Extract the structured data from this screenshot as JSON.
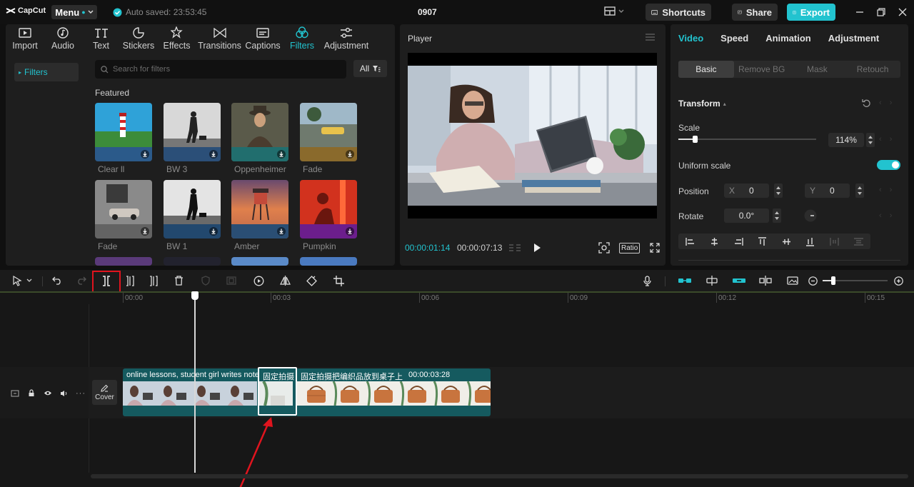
{
  "titlebar": {
    "app_name": "CapCut",
    "menu_label": "Menu",
    "autosave_text": "Auto saved: 23:53:45",
    "project_title": "0907",
    "shortcuts_label": "Shortcuts",
    "share_label": "Share",
    "export_label": "Export"
  },
  "media": {
    "tabs": [
      {
        "label": "Import",
        "icon": "import-icon"
      },
      {
        "label": "Audio",
        "icon": "audio-icon"
      },
      {
        "label": "Text",
        "icon": "text-icon"
      },
      {
        "label": "Stickers",
        "icon": "stickers-icon"
      },
      {
        "label": "Effects",
        "icon": "effects-icon"
      },
      {
        "label": "Transitions",
        "icon": "transitions-icon"
      },
      {
        "label": "Captions",
        "icon": "captions-icon"
      },
      {
        "label": "Filters",
        "icon": "filters-icon",
        "active": true
      },
      {
        "label": "Adjustment",
        "icon": "adjustment-icon"
      }
    ],
    "side_item": "Filters",
    "search_placeholder": "Search for filters",
    "all_label": "All",
    "section_title": "Featured",
    "filters": [
      {
        "name": "Clear ll"
      },
      {
        "name": "BW 3"
      },
      {
        "name": "Oppenheimer"
      },
      {
        "name": "Fade"
      },
      {
        "name": "Fade"
      },
      {
        "name": "BW 1"
      },
      {
        "name": "Amber"
      },
      {
        "name": "Pumpkin"
      }
    ]
  },
  "player": {
    "title": "Player",
    "current_time": "00:00:01:14",
    "total_time": "00:00:07:13",
    "ratio_label": "Ratio"
  },
  "props": {
    "tabs": [
      "Video",
      "Speed",
      "Animation",
      "Adjustment"
    ],
    "subtabs": [
      "Basic",
      "Remove BG",
      "Mask",
      "Retouch"
    ],
    "transform_label": "Transform",
    "scale_label": "Scale",
    "scale_value": "114%",
    "scale_fraction": 0.12,
    "uniform_scale_label": "Uniform scale",
    "uniform_scale_on": true,
    "position_label": "Position",
    "pos_x_label": "X",
    "pos_x_value": "0",
    "pos_y_label": "Y",
    "pos_y_value": "0",
    "rotate_label": "Rotate",
    "rotate_value": "0.0°"
  },
  "timeline": {
    "ruler_labels": [
      "00:00",
      "00:03",
      "00:06",
      "00:09",
      "00:12",
      "00:15"
    ],
    "cover_label": "Cover",
    "clips": [
      {
        "label": "online lessons, student girl writes note"
      },
      {
        "label": "固定拍摄"
      },
      {
        "label": "固定拍摄把编织品放到桌子上",
        "duration": "00:00:03:28"
      }
    ]
  },
  "colors": {
    "accent": "#22c3cf",
    "clip": "#155a5f",
    "highlight": "#e0141e"
  }
}
